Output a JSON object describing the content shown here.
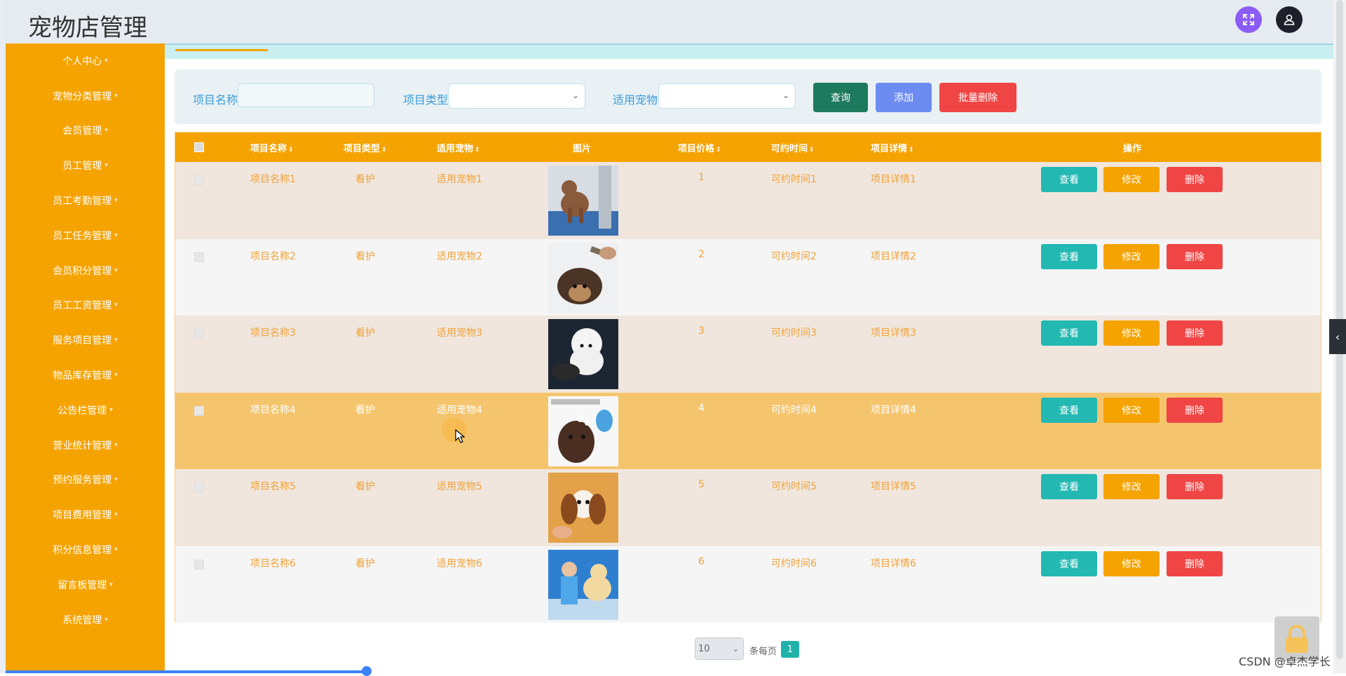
{
  "app": {
    "title": "宠物店管理"
  },
  "header": {
    "fullscreen_icon": "expand-icon",
    "user_icon": "user-icon",
    "fullscreen_color": "#8b5cf6"
  },
  "sidebar": {
    "items": [
      {
        "label": "个人中心"
      },
      {
        "label": "宠物分类管理"
      },
      {
        "label": "会员管理"
      },
      {
        "label": "员工管理"
      },
      {
        "label": "员工考勤管理"
      },
      {
        "label": "员工任务管理"
      },
      {
        "label": "会员积分管理"
      },
      {
        "label": "员工工资管理"
      },
      {
        "label": "服务项目管理"
      },
      {
        "label": "物品库存管理"
      },
      {
        "label": "公告栏管理"
      },
      {
        "label": "营业统计管理"
      },
      {
        "label": "预约服务管理"
      },
      {
        "label": "项目费用管理"
      },
      {
        "label": "积分信息管理"
      },
      {
        "label": "留言板管理"
      },
      {
        "label": "系统管理"
      }
    ],
    "color": "#f5a300"
  },
  "search": {
    "name_label": "项目名称",
    "name_value": "",
    "type_label": "项目类型",
    "type_value": "",
    "pet_label": "适用宠物",
    "pet_value": "",
    "query_button": "查询",
    "add_button": "添加",
    "bulk_delete_button": "批量删除"
  },
  "table": {
    "columns": [
      "项目名称",
      "项目类型",
      "适用宠物",
      "图片",
      "项目价格",
      "可约时间",
      "项目详情",
      "操作"
    ],
    "rows": [
      {
        "name": "项目名称1",
        "type": "看护",
        "pet": "适用宠物1",
        "price": "1",
        "time": "可约时间1",
        "detail": "项目详情1",
        "image": "poodle-grooming-photo"
      },
      {
        "name": "项目名称2",
        "type": "看护",
        "pet": "适用宠物2",
        "price": "2",
        "time": "可约时间2",
        "detail": "项目详情2",
        "image": "terrier-brushing-photo"
      },
      {
        "name": "项目名称3",
        "type": "看护",
        "pet": "适用宠物3",
        "price": "3",
        "time": "可约时间3",
        "detail": "项目详情3",
        "image": "white-poodle-photo"
      },
      {
        "name": "项目名称4",
        "type": "看护",
        "pet": "适用宠物4",
        "price": "4",
        "time": "可约时间4",
        "detail": "项目详情4",
        "image": "dog-bath-photo"
      },
      {
        "name": "项目名称5",
        "type": "看护",
        "pet": "适用宠物5",
        "price": "5",
        "time": "可约时间5",
        "detail": "项目详情5",
        "image": "spaniel-grooming-photo"
      },
      {
        "name": "项目名称6",
        "type": "看护",
        "pet": "适用宠物6",
        "price": "6",
        "time": "可约时间6",
        "detail": "项目详情6",
        "image": "vet-dog-photo"
      }
    ],
    "actions": {
      "view": "查看",
      "edit": "修改",
      "delete": "删除"
    },
    "header_color": "#f5a300"
  },
  "pagination": {
    "page_size": "10",
    "page_size_label": "条每页",
    "current_page": "1"
  },
  "watermark": "CSDN @卓杰学长"
}
